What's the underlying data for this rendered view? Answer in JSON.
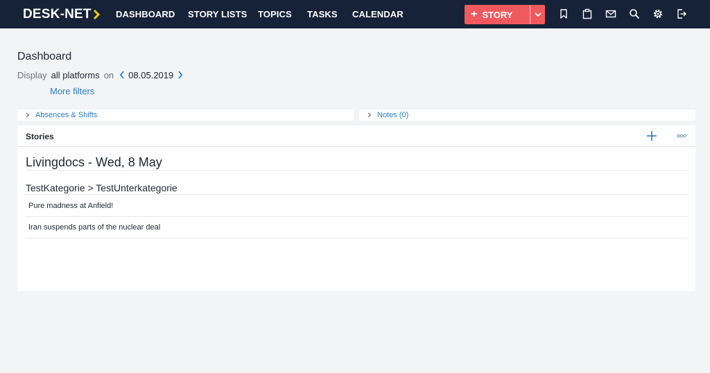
{
  "app": {
    "logo_text": "DESK-NET",
    "accent": "#f05a5f",
    "nav_bg": "#162237",
    "logo_arrow_color": "#f5c518"
  },
  "nav": {
    "items": [
      {
        "label": "DASHBOARD"
      },
      {
        "label": "STORY LISTS"
      },
      {
        "label": "TOPICS"
      },
      {
        "label": "TASKS"
      },
      {
        "label": "CALENDAR"
      }
    ],
    "new_story": {
      "icon": "plus-icon",
      "label": "STORY",
      "dropdown_icon": "chevron-down-icon"
    },
    "icons": [
      "bookmark-icon",
      "clipboard-icon",
      "mail-icon",
      "search-icon",
      "gear-icon",
      "logout-icon"
    ]
  },
  "page": {
    "title": "Dashboard",
    "display_label": "Display",
    "platforms": "all platforms",
    "on_label": "on",
    "date": "08.05.2019",
    "more_filters": "More filters"
  },
  "sections": {
    "absences": "Absences & Shifts",
    "notes": "Notes (0)"
  },
  "stories_panel": {
    "title": "Stories",
    "platform_heading": "Livingdocs - Wed, 8 May",
    "category": "TestKategorie > TestUnterkategorie",
    "items": [
      {
        "title": "Pure madness at Anfield!"
      },
      {
        "title": "Iran suspends parts of the nuclear deal"
      }
    ]
  }
}
